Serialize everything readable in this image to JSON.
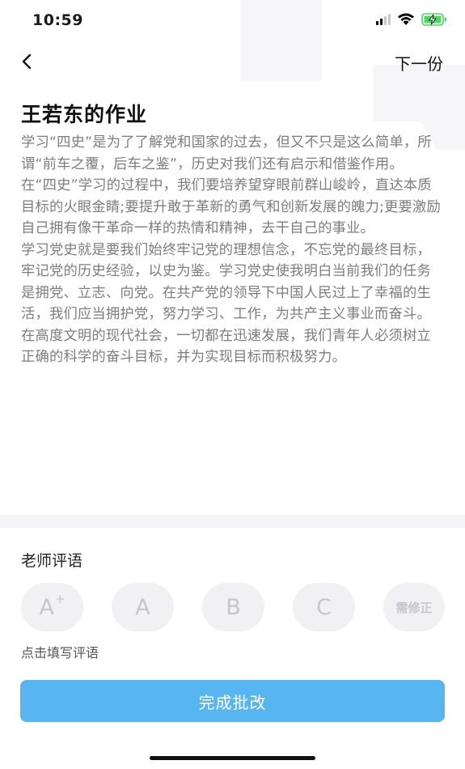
{
  "status_bar": {
    "time": "10:59",
    "icons": [
      "cellular-signal-icon",
      "wifi-icon",
      "battery-charging-icon"
    ],
    "battery_color": "#4cd964"
  },
  "nav": {
    "back_icon": "chevron-left-icon",
    "next_label": "下一份"
  },
  "assignment": {
    "title": "王若东的作业",
    "paragraphs": [
      "学习“四史”是为了了解党和国家的过去，但又不只是这么简单，所谓“前车之覆，后车之鉴”，历史对我们还有启示和借鉴作用。",
      "在“四史”学习的过程中，我们要培养望穿眼前群山峻岭，直达本质目标的火眼金睛;要提升敢于革新的勇气和创新发展的魄力;更要激励自己拥有像干革命一样的热情和精神，去干自己的事业。",
      "学习党史就是要我们始终牢记党的理想信念，不忘党的最终目标，牢记党的历史经验，以史为鉴。学习党史使我明白当前我们的任务是拥党、立志、向党。在共产党的领导下中国人民过上了幸福的生活，我们应当拥护党，努力学习、工作，为共产主义事业而奋斗。在高度文明的现代社会，一切都在迅速发展，我们青年人必须树立正确的科学的奋斗目标，并为实现目标而积极努力。"
    ]
  },
  "review": {
    "section_label": "老师评语",
    "grades": [
      {
        "main": "A",
        "sup": "+"
      },
      {
        "main": "A",
        "sup": ""
      },
      {
        "main": "B",
        "sup": ""
      },
      {
        "main": "C",
        "sup": ""
      },
      {
        "main": "需修正",
        "sup": ""
      }
    ],
    "comment_hint": "点击填写评语",
    "submit_label": "完成批改"
  },
  "colors": {
    "accent": "#57b6f0",
    "grade_bg": "#f1f1f4",
    "grade_text": "#c6c6cb",
    "body_text": "#7d7d7d"
  }
}
